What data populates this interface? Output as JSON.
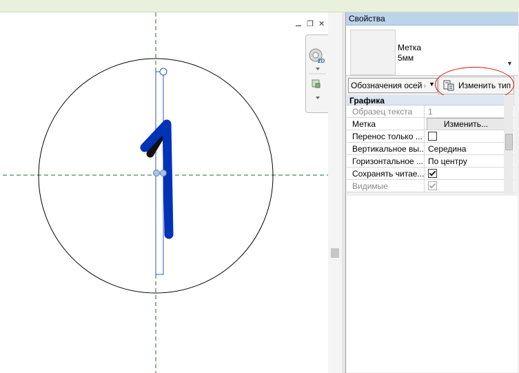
{
  "window_controls": {
    "minimize": "⚊",
    "restore": "❐",
    "close": "✕"
  },
  "nav_bar": {
    "badge_2d": "2D"
  },
  "canvas": {
    "grid_bubble_label": "1"
  },
  "properties": {
    "title": "Свойства",
    "type_name_line1": "Метка",
    "type_name_line2": "5мм",
    "selector_text": "Обозначения осей (",
    "edit_type_label": "Изменить тип",
    "group_label": "Графика",
    "rows": [
      {
        "name": "Образец текста",
        "value": "1",
        "kind": "text",
        "disabled": true
      },
      {
        "name": "Метка",
        "value": "Изменить...",
        "kind": "button",
        "disabled": false
      },
      {
        "name": "Перенос только ...",
        "value": false,
        "kind": "checkbox",
        "disabled": false
      },
      {
        "name": "Вертикальное вы...",
        "value": "Середина",
        "kind": "text",
        "disabled": false
      },
      {
        "name": "Горизонтальное ...",
        "value": "По центру",
        "kind": "text",
        "disabled": false
      },
      {
        "name": "Сохранять читае...",
        "value": true,
        "kind": "checkbox",
        "disabled": false
      },
      {
        "name": "Видимые",
        "value": true,
        "kind": "checkbox",
        "disabled": true
      }
    ]
  },
  "colors": {
    "grid_line": "#1f6b2a",
    "digit_blue": "#0033b8",
    "panel_header": "#bcd3ec",
    "annotation_red": "#e01010"
  }
}
